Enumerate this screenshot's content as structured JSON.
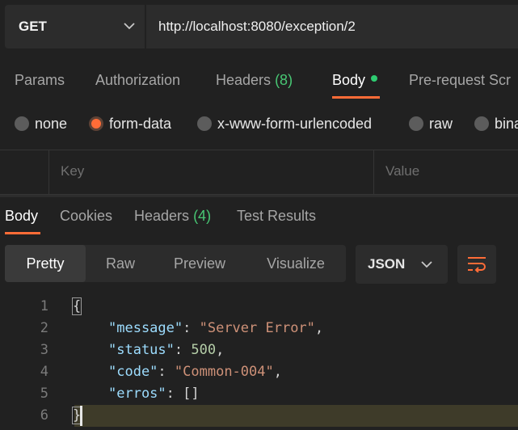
{
  "request": {
    "method": "GET",
    "url": "http://localhost:8080/exception/2"
  },
  "request_tabs": {
    "params": "Params",
    "authorization": "Authorization",
    "headers_label": "Headers",
    "headers_count": "(8)",
    "body": "Body",
    "prerequest": "Pre-request Scr"
  },
  "body_types": {
    "none": "none",
    "form_data": "form-data",
    "urlencoded": "x-www-form-urlencoded",
    "raw": "raw",
    "binary": "bina",
    "selected": "form-data"
  },
  "kv_table": {
    "key_header": "Key",
    "value_header": "Value"
  },
  "response_tabs": {
    "body": "Body",
    "cookies": "Cookies",
    "headers_label": "Headers",
    "headers_count": "(4)",
    "test_results": "Test Results"
  },
  "view_modes": {
    "pretty": "Pretty",
    "raw": "Raw",
    "preview": "Preview",
    "visualize": "Visualize",
    "selected": "Pretty"
  },
  "format": {
    "label": "JSON"
  },
  "code": {
    "line_numbers": [
      "1",
      "2",
      "3",
      "4",
      "5",
      "6"
    ],
    "open_brace": "{",
    "close_brace": "}",
    "message_key": "\"message\"",
    "message_value": "\"Server Error\"",
    "status_key": "\"status\"",
    "status_value": "500",
    "code_key": "\"code\"",
    "code_value": "\"Common-004\"",
    "erros_key": "\"erros\"",
    "erros_value": "[]"
  },
  "colors": {
    "accent": "#ff6c37",
    "success": "#2ecc71",
    "background": "#212121",
    "json_key": "#9cdcfe",
    "json_string": "#ce9178",
    "json_number": "#b5cea8"
  }
}
